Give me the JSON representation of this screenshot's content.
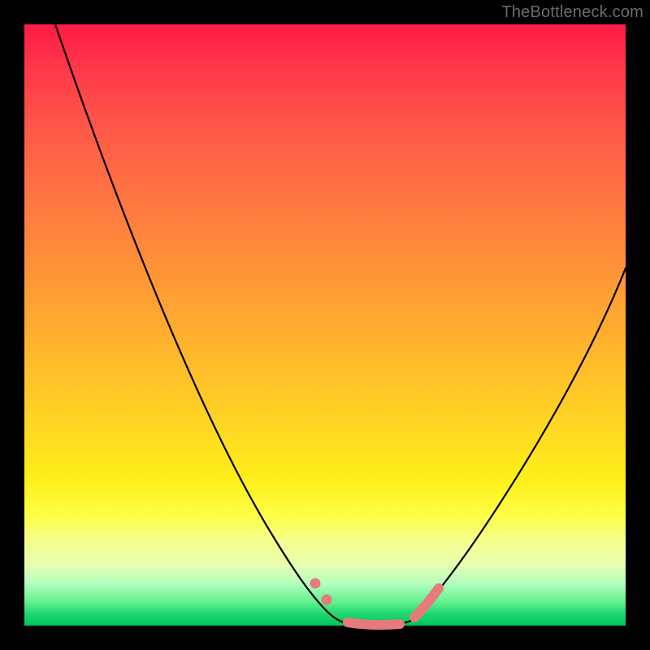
{
  "watermark": "TheBottleneck.com",
  "colors": {
    "frame": "#000000",
    "gradient_top": "#ff1a45",
    "gradient_mid": "#ffd423",
    "gradient_bottom": "#00c45c",
    "curve": "#000000",
    "marker": "#e77a7a"
  },
  "chart_data": {
    "type": "line",
    "title": "",
    "xlabel": "",
    "ylabel": "",
    "xlim": [
      0,
      100
    ],
    "ylim": [
      0,
      100
    ],
    "series": [
      {
        "name": "left-curve",
        "x": [
          6,
          10,
          15,
          20,
          25,
          30,
          35,
          40,
          45,
          48,
          50,
          52
        ],
        "y": [
          100,
          90,
          78,
          66,
          54,
          42,
          31,
          21,
          12,
          7,
          3,
          1
        ]
      },
      {
        "name": "valley-floor",
        "x": [
          52,
          55,
          58,
          61,
          64
        ],
        "y": [
          1,
          0.5,
          0.4,
          0.6,
          1.5
        ]
      },
      {
        "name": "right-curve",
        "x": [
          64,
          68,
          72,
          76,
          80,
          84,
          88,
          92,
          96,
          100
        ],
        "y": [
          1.5,
          6,
          12,
          19,
          27,
          35,
          44,
          53,
          58,
          60
        ]
      }
    ],
    "markers": [
      {
        "name": "left-dot-1",
        "x": 47.5,
        "y": 8.5
      },
      {
        "name": "left-dot-2",
        "x": 49.5,
        "y": 5.0
      },
      {
        "name": "right-cap",
        "x_from": 64,
        "x_to": 67,
        "y_from": 2,
        "y_to": 6
      },
      {
        "name": "valley-floor-mark",
        "x_from": 52,
        "x_to": 63,
        "y": 0.7
      }
    ]
  }
}
